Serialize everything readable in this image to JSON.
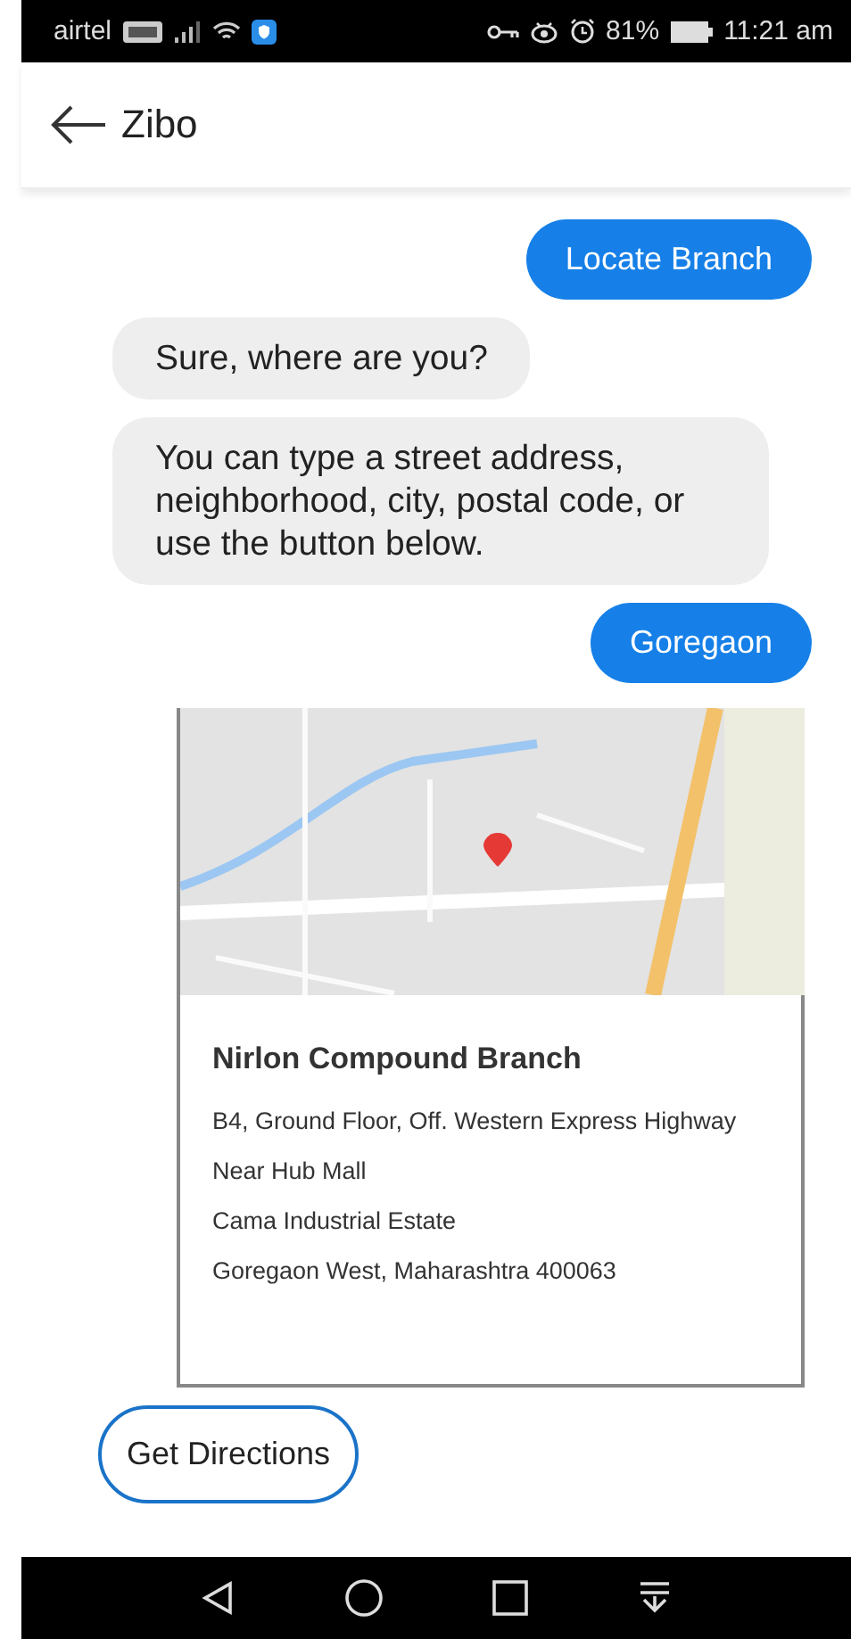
{
  "status_bar": {
    "carrier": "airtel",
    "battery": "81%",
    "time": "11:21 am"
  },
  "header": {
    "title": "Zibo"
  },
  "messages": [
    {
      "kind": "user",
      "text": "Locate Branch"
    },
    {
      "kind": "bot",
      "text": "Sure, where are you?"
    },
    {
      "kind": "bot",
      "text": "You can type a street address, neighborhood, city, postal code, or use the button below."
    },
    {
      "kind": "user",
      "text": "Goregaon"
    }
  ],
  "branch_card": {
    "name": "Nirlon Compound Branch",
    "address_lines": [
      "B4, Ground Floor, Off. Western Express Highway",
      "Near Hub Mall",
      "Cama Industrial Estate",
      "Goregaon West, Maharashtra 400063"
    ]
  },
  "action_button": {
    "label": "Get Directions"
  }
}
